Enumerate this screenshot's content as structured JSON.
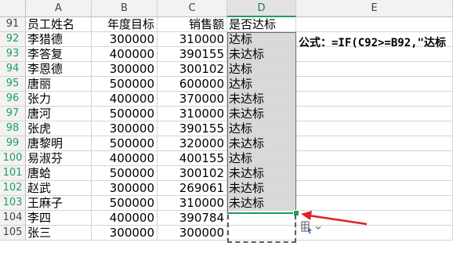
{
  "columns": [
    "A",
    "B",
    "C",
    "D",
    "E"
  ],
  "header_row": {
    "row": "91",
    "name": "员工姓名",
    "target": "年度目标",
    "sales": "销售额",
    "status": "是否达标"
  },
  "rows": [
    {
      "row": "92",
      "name": "李猎德",
      "target": "300000",
      "sales": "310000",
      "status": "达标"
    },
    {
      "row": "93",
      "name": "李答复",
      "target": "400000",
      "sales": "390155",
      "status": "未达标"
    },
    {
      "row": "94",
      "name": "李恩德",
      "target": "300000",
      "sales": "300102",
      "status": "达标"
    },
    {
      "row": "95",
      "name": "唐丽",
      "target": "500000",
      "sales": "600000",
      "status": "达标"
    },
    {
      "row": "96",
      "name": "张力",
      "target": "400000",
      "sales": "370000",
      "status": "未达标"
    },
    {
      "row": "97",
      "name": "唐河",
      "target": "500000",
      "sales": "310000",
      "status": "未达标"
    },
    {
      "row": "98",
      "name": "张虎",
      "target": "300000",
      "sales": "390155",
      "status": "达标"
    },
    {
      "row": "99",
      "name": "唐黎明",
      "target": "500000",
      "sales": "320000",
      "status": "未达标"
    },
    {
      "row": "100",
      "name": "易淑芬",
      "target": "400000",
      "sales": "400155",
      "status": "达标"
    },
    {
      "row": "101",
      "name": "唐蛤",
      "target": "500000",
      "sales": "300102",
      "status": "未达标"
    },
    {
      "row": "102",
      "name": "赵武",
      "target": "300000",
      "sales": "269061",
      "status": "未达标"
    },
    {
      "row": "103",
      "name": "王麻子",
      "target": "500000",
      "sales": "310000",
      "status": "未达标"
    },
    {
      "row": "104",
      "name": "李四",
      "target": "400000",
      "sales": "390784",
      "status": ""
    },
    {
      "row": "105",
      "name": "张三",
      "target": "300000",
      "sales": "300000",
      "status": ""
    }
  ],
  "formula_note": "公式：=IF(C92>=B92,\"达标",
  "colors": {
    "selection": "#d9d9d9",
    "accent": "#1e9e59",
    "arrow": "#e02020"
  },
  "icons": {
    "autofill": "autofill-options-icon",
    "arrow": "red-arrow"
  }
}
